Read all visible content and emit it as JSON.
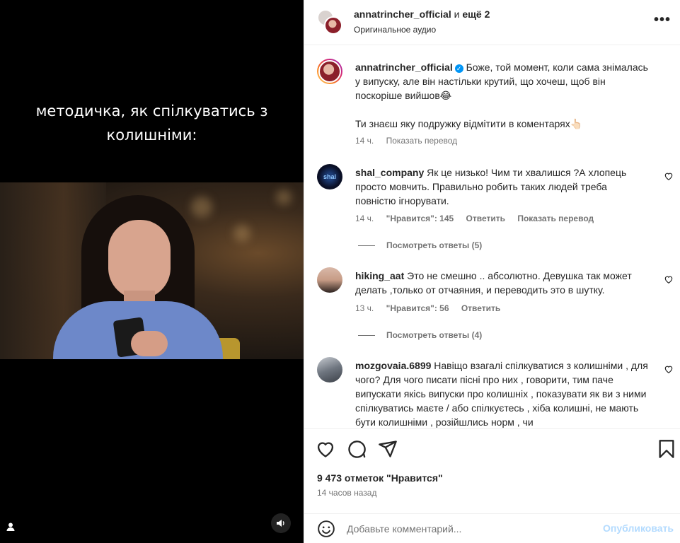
{
  "media": {
    "caption_line1": "методичка, як спілкуватись з",
    "caption_line2": "колишніми:"
  },
  "header": {
    "username": "annatrincher_official",
    "and": " и ",
    "more": "ещё 2",
    "audio": "Оригинальное аудио"
  },
  "caption": {
    "username": "annatrincher_official",
    "text_line1": "Боже, той момент, коли сама знімалась",
    "text_line2": "у випуску, але він настільки крутий, що хочеш, щоб він",
    "text_line3": "поскоріше вийшов😂",
    "text_line4": "Ти знаєш яку подружку відмітити в коментарях👆🏻",
    "time": "14 ч.",
    "translate": "Показать перевод"
  },
  "comments": [
    {
      "username": "shal_company",
      "text": "Як це низько! Чим ти хвалишся ?А хлопець просто мовчить. Правильно робить таких людей треба повністю ігнорувати.",
      "time": "14 ч.",
      "likes": "\"Нравится\": 145",
      "reply": "Ответить",
      "translate": "Показать перевод",
      "replies": "Посмотреть ответы (5)"
    },
    {
      "username": "hiking_aat",
      "text": "Это не смешно .. абсолютно. Девушка так может делать ,только от отчаяния, и переводить это в шутку.",
      "time": "13 ч.",
      "likes": "\"Нравится\": 56",
      "reply": "Ответить",
      "replies": "Посмотреть ответы (4)"
    },
    {
      "username": "mozgovaia.6899",
      "text": "Навіщо взагалі спілкуватися з колишніми , для чого? Для чого писати пісні про них , говорити, тим паче випускати якісь випуски про колишніх , показувати як ви з ними спілкуватись маєте / або спілкуєтесь , хіба колишні, не мають бути колишніми , розійшлись норм , чи"
    }
  ],
  "footer": {
    "likes": "9 473 отметок \"Нравится\"",
    "time": "14 часов назад",
    "comment_placeholder": "Добавьте комментарий...",
    "post_label": "Опубликовать"
  },
  "icons": {
    "heart": "heart-icon",
    "comment": "comment-icon",
    "share": "share-icon",
    "save": "bookmark-icon",
    "emoji": "emoji-icon",
    "sound": "speaker-icon",
    "user": "user-icon",
    "more": "more-icon"
  },
  "colors": {
    "accent": "#0095f6",
    "post_button_disabled": "#b3dbff",
    "muted_text": "#737373"
  }
}
